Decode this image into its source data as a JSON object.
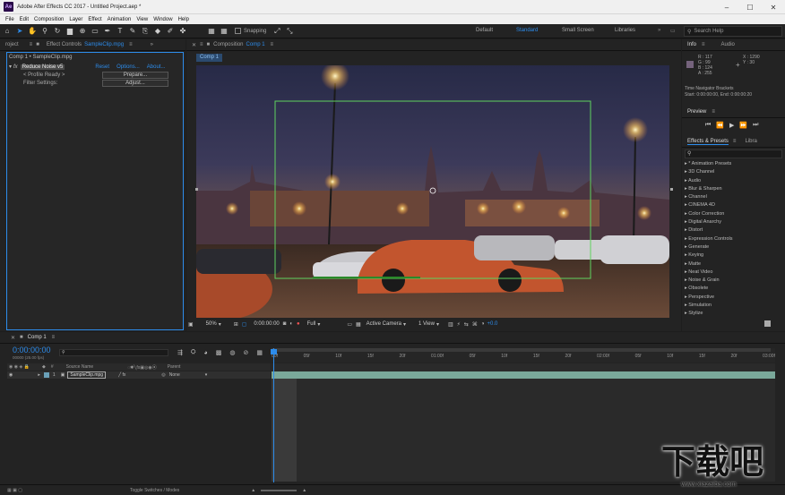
{
  "window": {
    "title": "Adobe After Effects CC 2017 - Untitled Project.aep *",
    "app_icon": "Ae",
    "min": "–",
    "max": "☐",
    "close": "✕"
  },
  "menu": [
    "File",
    "Edit",
    "Composition",
    "Layer",
    "Effect",
    "Animation",
    "View",
    "Window",
    "Help"
  ],
  "toolbar": {
    "snapping": "Snapping",
    "workspaces": [
      "Default",
      "Standard",
      "Small Screen",
      "Libraries"
    ],
    "active_workspace": "Standard",
    "search_placeholder": "Search Help"
  },
  "left": {
    "tab_project": "roject",
    "tab_effect_controls": "Effect Controls",
    "tab_effect_controls_clip": "SampleClip.mpg",
    "breadcrumb": "Comp 1 • SampleClip.mpg",
    "effect_name": "Reduce Noise v5",
    "effect_reset": "Reset",
    "effect_options": "Options...",
    "effect_about": "About...",
    "profile_label": "< Profile Ready >",
    "prepare_button": "Prepare...",
    "filter_label": "Filter Settings:",
    "adjust_button": "Adjust..."
  },
  "comp": {
    "tab_label": "Composition",
    "tab_name": "Comp 1",
    "sub_tab": "Comp 1",
    "zoom": "50%",
    "timecode": "0:00:00:00",
    "resolution": "Full",
    "camera": "Active Camera",
    "views": "1 View",
    "exposure": "+0.0"
  },
  "right": {
    "tab_info": "Info",
    "tab_audio": "Audio",
    "color_r": "R : 117",
    "color_g": "G : 99",
    "color_b": "B : 124",
    "color_a": "A : 255",
    "coord_x": "X : 1290",
    "coord_y": "Y : 30",
    "tn_title": "Time Navigator Brackets",
    "tn_range": "Start: 0:00:00:00, End: 0:00:00:20",
    "preview_title": "Preview",
    "effects_tab": "Effects & Presets",
    "libraries_tab": "Libra",
    "effects_search_placeholder": "",
    "categories": [
      "* Animation Presets",
      "3D Channel",
      "Audio",
      "Blur & Sharpen",
      "Channel",
      "CINEMA 4D",
      "Color Correction",
      "Digital Anarchy",
      "Distort",
      "Expression Controls",
      "Generate",
      "Keying",
      "Matte",
      "Neat Video",
      "Noise & Grain",
      "Obsolete",
      "Perspective",
      "Simulation",
      "Stylize"
    ]
  },
  "timeline": {
    "comp_tab": "Comp 1",
    "timecode": "0:00:00:00",
    "frame_info": "00000 (25.00 fps)",
    "col_source": "Source Name",
    "col_parent": "Parent",
    "layer_num": "1",
    "layer_name": "SampleClip.mpg",
    "parent_value": "None",
    "ruler": [
      "00f",
      "05f",
      "10f",
      "15f",
      "20f",
      "01:00f",
      "05f",
      "10f",
      "15f",
      "20f",
      "02:00f",
      "05f",
      "10f",
      "15f",
      "20f",
      "03:00f"
    ],
    "toggle_label": "Toggle Switches / Modes"
  },
  "watermark": {
    "brand": "下载吧",
    "url": "www.xiazaiba.com"
  },
  "colors": {
    "accent": "#2d8ceb",
    "info_swatch": "#75637c",
    "green_box": "#5fd35f"
  }
}
